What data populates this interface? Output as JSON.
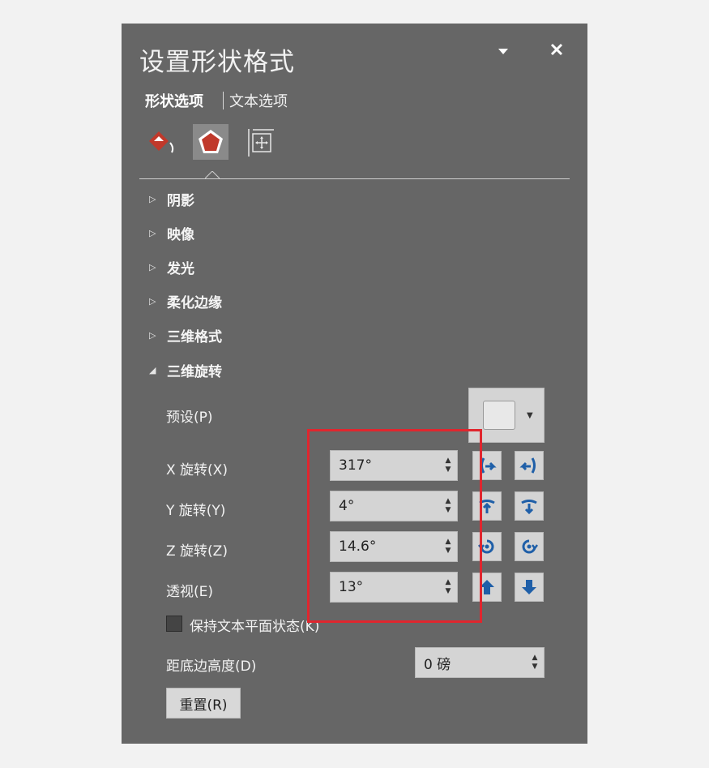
{
  "panel": {
    "title": "设置形状格式",
    "tabs": [
      {
        "label": "形状选项",
        "active": true
      },
      {
        "label": "文本选项",
        "active": false
      }
    ],
    "icons": [
      "fill-line-icon",
      "effects-icon",
      "size-properties-icon"
    ]
  },
  "sections": [
    {
      "label": "阴影",
      "expanded": false
    },
    {
      "label": "映像",
      "expanded": false
    },
    {
      "label": "发光",
      "expanded": false
    },
    {
      "label": "柔化边缘",
      "expanded": false
    },
    {
      "label": "三维格式",
      "expanded": false
    },
    {
      "label": "三维旋转",
      "expanded": true
    }
  ],
  "rotation": {
    "preset_label": "预设(P)",
    "x": {
      "label": "X 旋转(X)",
      "value": "317°"
    },
    "y": {
      "label": "Y 旋转(Y)",
      "value": "4°"
    },
    "z": {
      "label": "Z 旋转(Z)",
      "value": "14.6°"
    },
    "perspective": {
      "label": "透视(E)",
      "value": "13°"
    },
    "keep_text_flat": {
      "label": "保持文本平面状态(K)",
      "checked": false
    },
    "distance": {
      "label": "距底边高度(D)",
      "value": "0 磅"
    },
    "reset_label": "重置(R)"
  },
  "colors": {
    "panel_bg": "#666666",
    "accent_red": "#c0392b",
    "button_blue": "#1f5fa8",
    "highlight_red": "#e0262e"
  }
}
